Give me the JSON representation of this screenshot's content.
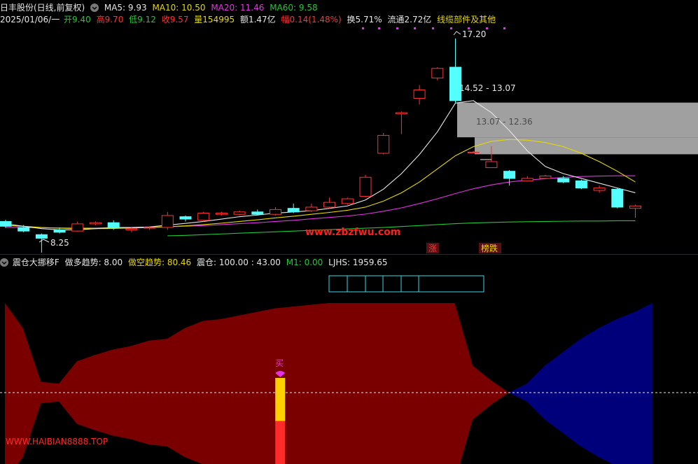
{
  "colors": {
    "bg": "#000000",
    "up": "#ff3333",
    "down": "#54ffff",
    "ma5": "#e6e6e6",
    "ma10": "#e6d800",
    "ma20": "#e433e4",
    "ma60": "#22c833",
    "volume_red": "#ff2a2a",
    "volume_yellow": "#ffd000"
  },
  "main": {
    "title": "日丰股份(日线,前复权)",
    "ma5": "MA5: 9.93",
    "ma10": "MA10: 10.50",
    "ma20": "MA20: 11.46",
    "ma60": "MA60: 9.58",
    "date": "2025/01/06/一",
    "open": "开9.40",
    "high": "高9.70",
    "low": "低9.12",
    "close": "收9.57",
    "volume": "量154995",
    "amount": "额1.47亿",
    "change": "幅0.14(1.48%)",
    "turnover": "换5.71%",
    "float_cap": "流通2.72亿",
    "sector": "线缆部件及其他",
    "high_label": "17.20",
    "low_label": "8.25",
    "zone1_label": "14.52 - 13.07",
    "zone2_label": "13.07 - 12.36",
    "watermark": "www.zbzfwu.com",
    "tag_zhang": "涨",
    "tag_bangdie": "榜跌"
  },
  "sub": {
    "title": "震仓大挪移F",
    "long_trend": "做多趋势: 8.00",
    "short_trend": "做空趋势: 80.46",
    "shake": "震仓: 100.00",
    "shake_val2": ": 43.00",
    "m1": "M1: 0.00",
    "ljhs": "LJHS: 1959.65",
    "buy_label": "买",
    "site": "WWW.HAIBIAN8888.TOP"
  },
  "chart_data": [
    {
      "type": "candlestick",
      "title": "日丰股份(日线,前复权)",
      "candles": [
        {
          "o": 9.55,
          "h": 9.62,
          "c": 9.35,
          "l": 9.28
        },
        {
          "o": 9.3,
          "h": 9.4,
          "c": 9.15,
          "l": 9.1
        },
        {
          "o": 9.0,
          "h": 9.05,
          "c": 8.85,
          "l": 8.25
        },
        {
          "o": 9.2,
          "h": 9.3,
          "c": 9.1,
          "l": 9.05
        },
        {
          "o": 9.15,
          "h": 9.55,
          "c": 9.45,
          "l": 9.12
        },
        {
          "o": 9.45,
          "h": 9.55,
          "c": 9.5,
          "l": 9.4
        },
        {
          "o": 9.5,
          "h": 9.6,
          "c": 9.28,
          "l": 9.2
        },
        {
          "o": 9.2,
          "h": 9.3,
          "c": 9.25,
          "l": 9.1
        },
        {
          "o": 9.28,
          "h": 9.35,
          "c": 9.3,
          "l": 9.2
        },
        {
          "o": 9.3,
          "h": 9.95,
          "c": 9.8,
          "l": 9.2
        },
        {
          "o": 9.75,
          "h": 9.8,
          "c": 9.65,
          "l": 9.55
        },
        {
          "o": 9.6,
          "h": 9.95,
          "c": 9.9,
          "l": 9.55
        },
        {
          "o": 9.85,
          "h": 9.95,
          "c": 9.9,
          "l": 9.8
        },
        {
          "o": 9.85,
          "h": 10.0,
          "c": 9.95,
          "l": 9.8
        },
        {
          "o": 9.95,
          "h": 10.05,
          "c": 9.85,
          "l": 9.8
        },
        {
          "o": 9.85,
          "h": 10.15,
          "c": 10.05,
          "l": 9.8
        },
        {
          "o": 10.1,
          "h": 10.3,
          "c": 9.95,
          "l": 9.9
        },
        {
          "o": 10.0,
          "h": 10.3,
          "c": 10.15,
          "l": 9.95
        },
        {
          "o": 10.15,
          "h": 10.55,
          "c": 10.35,
          "l": 10.1
        },
        {
          "o": 10.3,
          "h": 10.55,
          "c": 10.5,
          "l": 10.25
        },
        {
          "o": 10.6,
          "h": 11.5,
          "c": 11.4,
          "l": 10.55
        },
        {
          "o": 12.4,
          "h": 13.25,
          "c": 13.15,
          "l": 12.35
        },
        {
          "o": 14.05,
          "h": 14.15,
          "c": 14.1,
          "l": 13.2
        },
        {
          "o": 14.7,
          "h": 15.25,
          "c": 15.05,
          "l": 14.45
        },
        {
          "o": 15.55,
          "h": 16.0,
          "c": 15.95,
          "l": 15.45
        },
        {
          "o": 16.0,
          "h": 17.2,
          "c": 14.6,
          "l": 14.52
        },
        {
          "o": 12.45,
          "h": 12.5,
          "c": 12.45,
          "l": 12.4
        },
        {
          "o": 11.8,
          "h": 12.7,
          "c": 12.05,
          "l": 11.8
        },
        {
          "o": 11.65,
          "h": 11.7,
          "c": 11.35,
          "l": 11.05
        },
        {
          "o": 11.25,
          "h": 11.45,
          "c": 11.35,
          "l": 11.25
        },
        {
          "o": 11.35,
          "h": 11.5,
          "c": 11.45,
          "l": 11.35
        },
        {
          "o": 11.35,
          "h": 11.45,
          "c": 11.2,
          "l": 11.15
        },
        {
          "o": 11.25,
          "h": 11.3,
          "c": 10.95,
          "l": 10.9
        },
        {
          "o": 10.85,
          "h": 11.05,
          "c": 10.95,
          "l": 10.75
        },
        {
          "o": 10.9,
          "h": 10.95,
          "c": 10.15,
          "l": 10.1
        },
        {
          "o": 10.1,
          "h": 10.25,
          "c": 10.2,
          "l": 9.7
        }
      ],
      "ma5": [
        9.45,
        9.35,
        9.25,
        9.2,
        9.2,
        9.25,
        9.3,
        9.3,
        9.32,
        9.4,
        9.47,
        9.55,
        9.65,
        9.75,
        9.82,
        9.9,
        9.95,
        10.0,
        10.1,
        10.2,
        10.45,
        10.9,
        11.55,
        12.35,
        13.3,
        14.5,
        14.6,
        14.1,
        13.35,
        12.5,
        11.85,
        11.55,
        11.35,
        11.15,
        10.95,
        10.75
      ],
      "ma10": [
        9.38,
        9.35,
        9.3,
        9.27,
        9.25,
        9.25,
        9.26,
        9.28,
        9.3,
        9.33,
        9.37,
        9.42,
        9.48,
        9.55,
        9.62,
        9.7,
        9.77,
        9.85,
        9.93,
        10.02,
        10.15,
        10.4,
        10.75,
        11.2,
        11.75,
        12.3,
        12.68,
        12.9,
        12.98,
        12.95,
        12.85,
        12.68,
        12.4,
        12.05,
        11.65,
        11.2
      ],
      "ma20": [
        9.3,
        9.3,
        9.29,
        9.28,
        9.28,
        9.28,
        9.29,
        9.3,
        9.31,
        9.33,
        9.35,
        9.38,
        9.42,
        9.46,
        9.5,
        9.55,
        9.6,
        9.66,
        9.72,
        9.78,
        9.86,
        9.98,
        10.12,
        10.3,
        10.5,
        10.72,
        10.92,
        11.08,
        11.2,
        11.28,
        11.34,
        11.39,
        11.43,
        11.45,
        11.46,
        11.46
      ],
      "ma60": [
        null,
        null,
        null,
        null,
        null,
        null,
        null,
        null,
        null,
        8.95,
        8.97,
        9.0,
        9.03,
        9.06,
        9.09,
        9.12,
        9.15,
        9.18,
        9.21,
        9.24,
        9.27,
        9.3,
        9.34,
        9.38,
        9.42,
        9.46,
        9.49,
        9.51,
        9.53,
        9.54,
        9.55,
        9.56,
        9.57,
        9.57,
        9.58,
        9.58
      ],
      "zones": [
        {
          "from": 13.07,
          "to": 14.52
        },
        {
          "from": 12.36,
          "to": 13.07
        }
      ]
    },
    {
      "type": "area",
      "title": "震仓大挪移F",
      "x": [
        0,
        1,
        2,
        3,
        4,
        5,
        6,
        7,
        8,
        9,
        10,
        11,
        12,
        13,
        14,
        15,
        16,
        17,
        18,
        19,
        20,
        21,
        22,
        23,
        24,
        25,
        26,
        27,
        28,
        29,
        30,
        31,
        32,
        33,
        34,
        35,
        36
      ],
      "red_half_width": [
        100,
        72,
        12,
        10,
        35,
        42,
        48,
        52,
        58,
        60,
        72,
        80,
        82,
        86,
        90,
        94,
        96,
        98,
        100,
        100,
        100,
        100,
        100,
        100,
        100,
        100,
        30,
        14,
        0,
        0,
        0,
        0,
        0,
        0,
        0,
        0,
        0
      ],
      "blue_half_width": [
        0,
        0,
        0,
        0,
        0,
        0,
        0,
        0,
        0,
        0,
        0,
        0,
        0,
        0,
        0,
        0,
        0,
        0,
        0,
        0,
        0,
        0,
        0,
        0,
        0,
        0,
        0,
        0,
        0,
        10,
        30,
        45,
        60,
        72,
        82,
        90,
        100
      ],
      "buy_signal_x": 15.3,
      "buy_bar": {
        "yellow_top": 0.5,
        "red_top": 0.1
      }
    }
  ]
}
